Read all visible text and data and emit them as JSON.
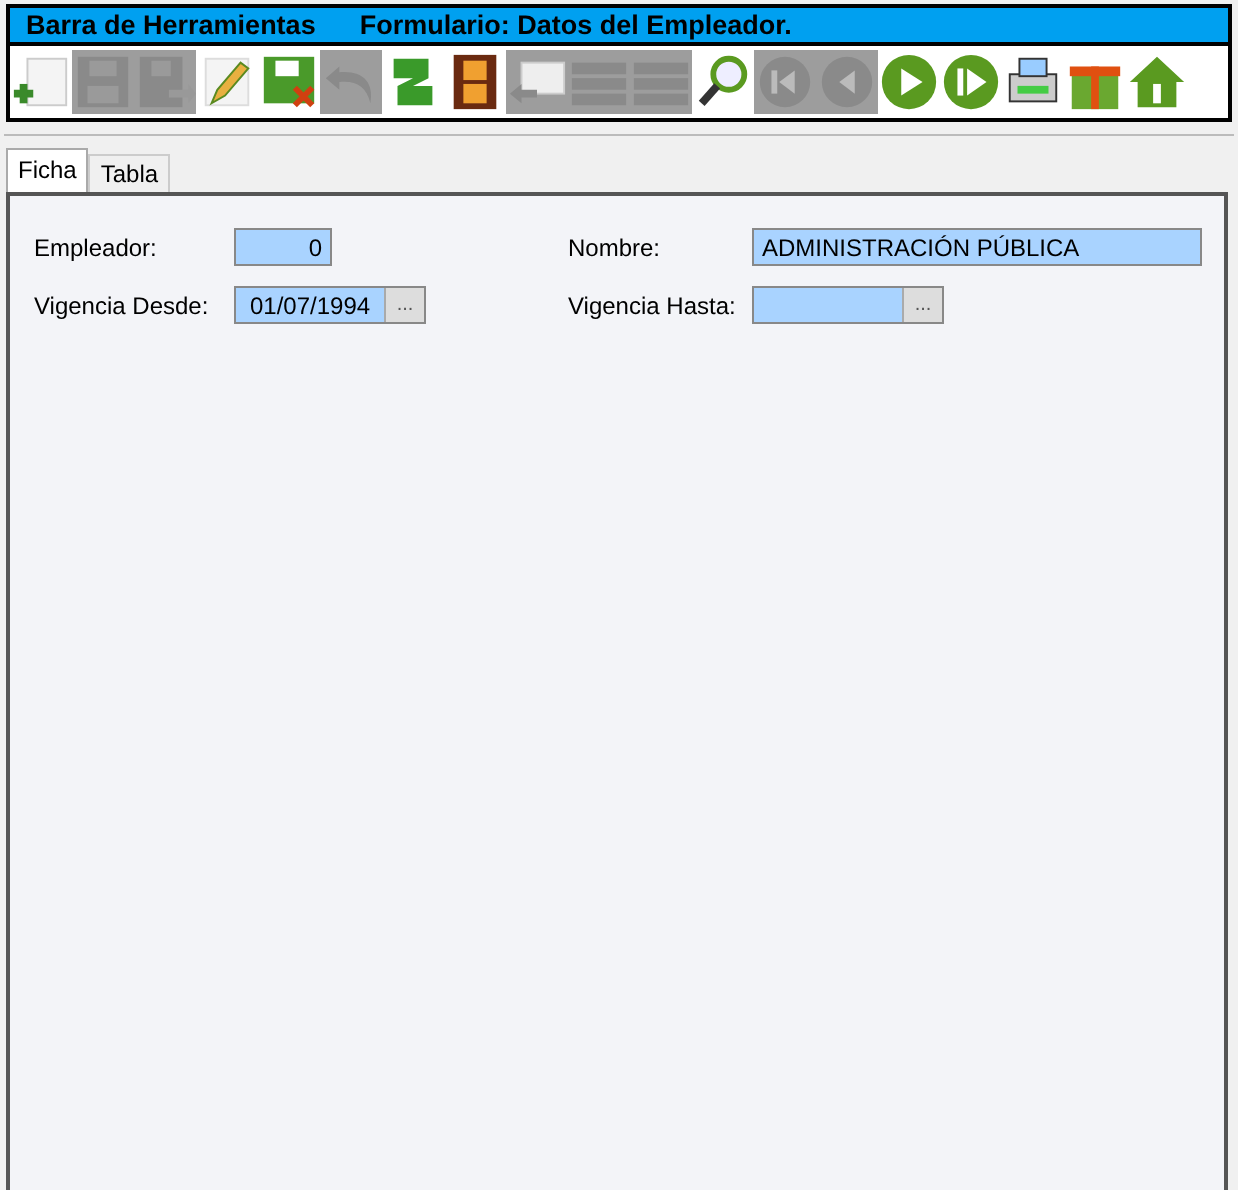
{
  "toolbar": {
    "title": "Barra de Herramientas",
    "form_title": "Formulario: Datos del Empleador.",
    "buttons": [
      {
        "kind": "new",
        "disabled": false
      },
      {
        "kind": "save",
        "disabled": true
      },
      {
        "kind": "save-as",
        "disabled": true
      },
      {
        "kind": "edit",
        "disabled": false
      },
      {
        "kind": "cancel-save",
        "disabled": false
      },
      {
        "kind": "undo",
        "disabled": true
      },
      {
        "kind": "refresh",
        "disabled": false
      },
      {
        "kind": "film",
        "disabled": false
      },
      {
        "kind": "reply",
        "disabled": true
      },
      {
        "kind": "list",
        "disabled": true
      },
      {
        "kind": "list",
        "disabled": true
      },
      {
        "kind": "search",
        "disabled": false
      },
      {
        "kind": "first",
        "disabled": true
      },
      {
        "kind": "prev",
        "disabled": true
      },
      {
        "kind": "next",
        "disabled": false
      },
      {
        "kind": "last",
        "disabled": false
      },
      {
        "kind": "print",
        "disabled": false
      },
      {
        "kind": "gift",
        "disabled": false
      },
      {
        "kind": "home",
        "disabled": false
      }
    ]
  },
  "tabs": [
    {
      "label": "Ficha",
      "selected": true
    },
    {
      "label": "Tabla",
      "selected": false
    }
  ],
  "fields": [
    {
      "label": "Empleador:",
      "value": "0",
      "kind": "number"
    },
    {
      "label": "Nombre:",
      "value": "ADMINISTRACIÓN PÚBLICA",
      "kind": "text"
    },
    {
      "label": "Vigencia Desde:",
      "value": "01/07/1994",
      "kind": "date",
      "button": "..."
    },
    {
      "label": "Vigencia Hasta:",
      "kind": "date",
      "button": "..."
    }
  ]
}
